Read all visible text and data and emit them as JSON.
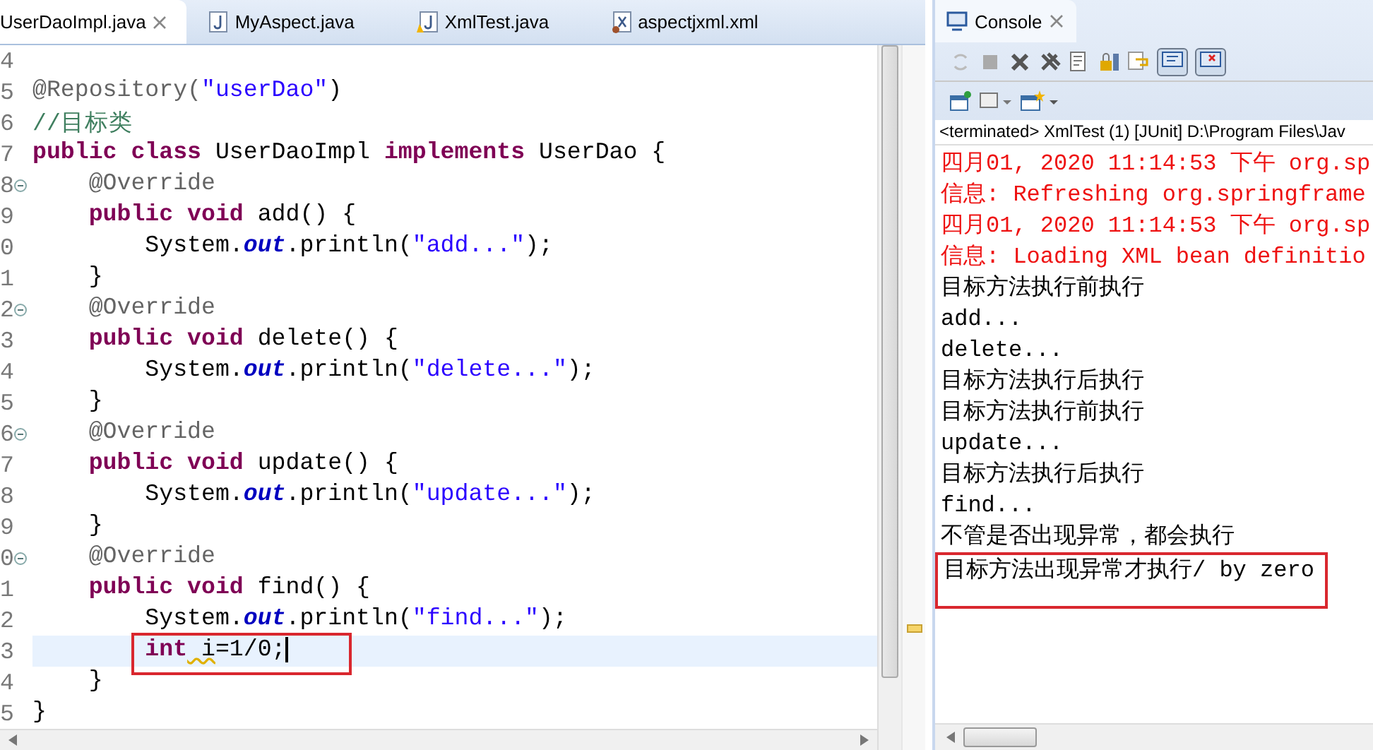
{
  "editor_tabs": [
    {
      "label": "UserDaoImpl.java",
      "selected": true
    },
    {
      "label": "MyAspect.java",
      "kind": "java",
      "selected": false
    },
    {
      "label": "XmlTest.java",
      "kind": "java-warning",
      "selected": false
    },
    {
      "label": "aspectjxml.xml",
      "kind": "xml",
      "selected": false
    }
  ],
  "code_lines": [
    {
      "number": "4",
      "fold": false,
      "current": false,
      "boxed": false
    },
    {
      "number": "5",
      "fold": false,
      "current": false,
      "boxed": false,
      "tokens": [
        {
          "kind": "annotation",
          "text": "@Repository("
        },
        {
          "kind": "string",
          "text": "\"userDao\""
        },
        {
          "kind": "plain",
          "text": ")"
        }
      ]
    },
    {
      "number": "6",
      "fold": false,
      "current": false,
      "boxed": false,
      "tokens": [
        {
          "kind": "comment",
          "text": "//目标类"
        }
      ]
    },
    {
      "number": "7",
      "fold": false,
      "current": false,
      "boxed": false,
      "tokens": [
        {
          "kind": "keyword",
          "text": "public class"
        },
        {
          "kind": "plain",
          "text": " UserDaoImpl "
        },
        {
          "kind": "keyword",
          "text": "implements"
        },
        {
          "kind": "plain",
          "text": " UserDao {"
        }
      ]
    },
    {
      "number": "8",
      "fold": true,
      "current": false,
      "boxed": false,
      "tokens": [
        {
          "kind": "annotation",
          "text": "    @Override"
        }
      ]
    },
    {
      "number": "9",
      "fold": false,
      "current": false,
      "boxed": false,
      "tokens": [
        {
          "kind": "keyword",
          "text": "    public void"
        },
        {
          "kind": "plain",
          "text": " add() {"
        }
      ]
    },
    {
      "number": "0",
      "fold": false,
      "current": false,
      "boxed": false,
      "tokens": [
        {
          "kind": "plain",
          "text": "        System."
        },
        {
          "kind": "field",
          "text": "out"
        },
        {
          "kind": "plain",
          "text": ".println("
        },
        {
          "kind": "string",
          "text": "\"add...\""
        },
        {
          "kind": "plain",
          "text": ");"
        }
      ]
    },
    {
      "number": "1",
      "fold": false,
      "current": false,
      "boxed": false,
      "tokens": [
        {
          "kind": "plain",
          "text": "    }"
        }
      ]
    },
    {
      "number": "2",
      "fold": true,
      "current": false,
      "boxed": false,
      "tokens": [
        {
          "kind": "annotation",
          "text": "    @Override"
        }
      ]
    },
    {
      "number": "3",
      "fold": false,
      "current": false,
      "boxed": false,
      "tokens": [
        {
          "kind": "keyword",
          "text": "    public void"
        },
        {
          "kind": "plain",
          "text": " delete() {"
        }
      ]
    },
    {
      "number": "4",
      "fold": false,
      "current": false,
      "boxed": false,
      "tokens": [
        {
          "kind": "plain",
          "text": "        System."
        },
        {
          "kind": "field",
          "text": "out"
        },
        {
          "kind": "plain",
          "text": ".println("
        },
        {
          "kind": "string",
          "text": "\"delete...\""
        },
        {
          "kind": "plain",
          "text": ");"
        }
      ]
    },
    {
      "number": "5",
      "fold": false,
      "current": false,
      "boxed": false,
      "tokens": [
        {
          "kind": "plain",
          "text": "    }"
        }
      ]
    },
    {
      "number": "6",
      "fold": true,
      "current": false,
      "boxed": false,
      "tokens": [
        {
          "kind": "annotation",
          "text": "    @Override"
        }
      ]
    },
    {
      "number": "7",
      "fold": false,
      "current": false,
      "boxed": false,
      "tokens": [
        {
          "kind": "keyword",
          "text": "    public void"
        },
        {
          "kind": "plain",
          "text": " update() {"
        }
      ]
    },
    {
      "number": "8",
      "fold": false,
      "current": false,
      "boxed": false,
      "tokens": [
        {
          "kind": "plain",
          "text": "        System."
        },
        {
          "kind": "field",
          "text": "out"
        },
        {
          "kind": "plain",
          "text": ".println("
        },
        {
          "kind": "string",
          "text": "\"update...\""
        },
        {
          "kind": "plain",
          "text": ");"
        }
      ]
    },
    {
      "number": "9",
      "fold": false,
      "current": false,
      "boxed": false,
      "tokens": [
        {
          "kind": "plain",
          "text": "    }"
        }
      ]
    },
    {
      "number": "0",
      "fold": true,
      "current": false,
      "boxed": false,
      "tokens": [
        {
          "kind": "annotation",
          "text": "    @Override"
        }
      ]
    },
    {
      "number": "1",
      "fold": false,
      "current": false,
      "boxed": false,
      "tokens": [
        {
          "kind": "keyword",
          "text": "    public void"
        },
        {
          "kind": "plain",
          "text": " find() {"
        }
      ]
    },
    {
      "number": "2",
      "fold": false,
      "current": false,
      "boxed": false,
      "tokens": [
        {
          "kind": "plain",
          "text": "        System."
        },
        {
          "kind": "field",
          "text": "out"
        },
        {
          "kind": "plain",
          "text": ".println("
        },
        {
          "kind": "string",
          "text": "\"find...\""
        },
        {
          "kind": "plain",
          "text": ");"
        }
      ]
    },
    {
      "number": "3",
      "fold": false,
      "current": true,
      "boxed": true,
      "tokens": [
        {
          "kind": "keyword",
          "text": "        int"
        },
        {
          "kind": "warning",
          "text": " i"
        },
        {
          "kind": "plain",
          "text": "=1/0;"
        }
      ]
    },
    {
      "number": "4",
      "fold": false,
      "current": false,
      "boxed": false,
      "tokens": [
        {
          "kind": "plain",
          "text": "    }"
        }
      ]
    },
    {
      "number": "5",
      "fold": false,
      "current": false,
      "boxed": false,
      "tokens": [
        {
          "kind": "plain",
          "text": "}"
        }
      ]
    }
  ],
  "console": {
    "title": "Console",
    "status": "<terminated> XmlTest (1) [JUnit] D:\\Program Files\\Jav",
    "lines": [
      {
        "color": "#ee1111",
        "text": "四月01, 2020 11:14:53 下午 org.sp",
        "boxed": false
      },
      {
        "color": "#ee1111",
        "text": "信息: Refreshing org.springframe",
        "boxed": false
      },
      {
        "color": "#ee1111",
        "text": "四月01, 2020 11:14:53 下午 org.sp",
        "boxed": false
      },
      {
        "color": "#ee1111",
        "text": "信息: Loading XML bean definitio",
        "boxed": false
      },
      {
        "color": "#000000",
        "text": "目标方法执行前执行",
        "boxed": false
      },
      {
        "color": "#000000",
        "text": "add...",
        "boxed": false
      },
      {
        "color": "#000000",
        "text": "delete...",
        "boxed": false
      },
      {
        "color": "#000000",
        "text": "目标方法执行后执行",
        "boxed": false
      },
      {
        "color": "#000000",
        "text": "目标方法执行前执行",
        "boxed": false
      },
      {
        "color": "#000000",
        "text": "update...",
        "boxed": false
      },
      {
        "color": "#000000",
        "text": "目标方法执行后执行",
        "boxed": false
      },
      {
        "color": "#000000",
        "text": "find...",
        "boxed": false
      },
      {
        "color": "#000000",
        "text": "不管是否出现异常，都会执行",
        "boxed": false
      },
      {
        "color": "#000000",
        "text": "目标方法出现异常才执行/ by zero",
        "boxed": true
      }
    ]
  }
}
